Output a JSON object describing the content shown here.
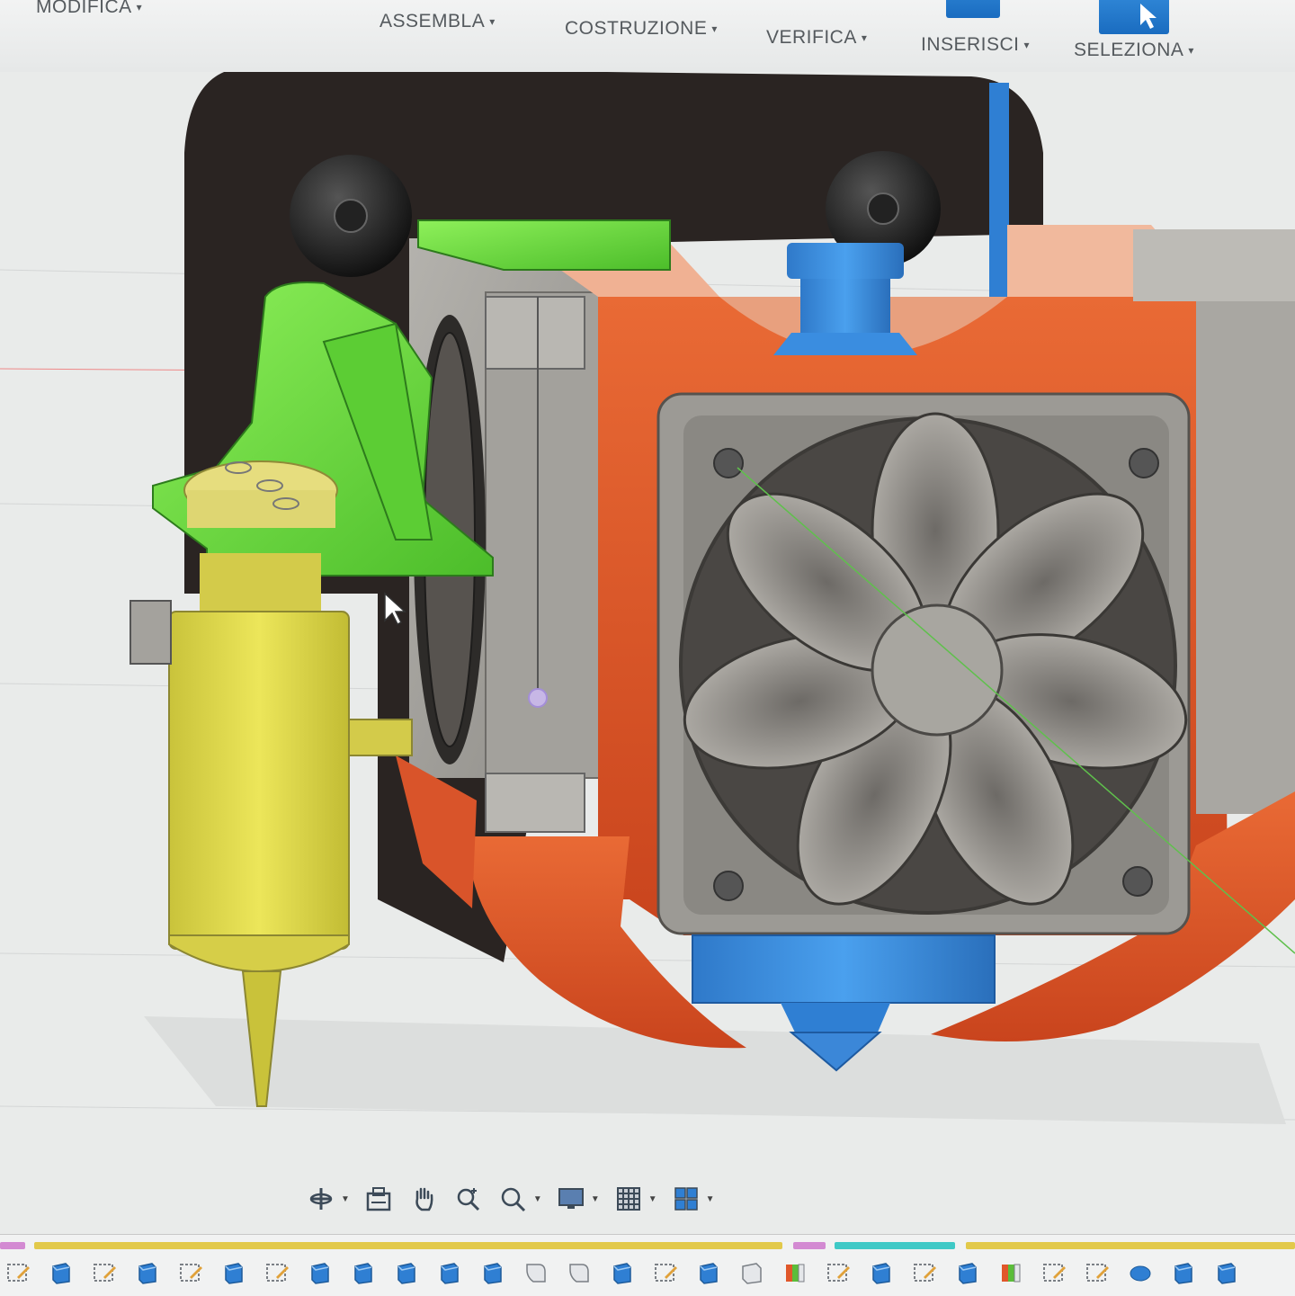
{
  "toolbar": {
    "menus": [
      {
        "label": "MODIFICA"
      },
      {
        "label": "ASSEMBLA"
      },
      {
        "label": "COSTRUZIONE"
      },
      {
        "label": "VERIFICA"
      },
      {
        "label": "INSERISCI"
      },
      {
        "label": "SELEZIONA"
      }
    ],
    "caret": "▾"
  },
  "viewport": {
    "model": "3d-printer-hotend-fan-shroud-assembly",
    "colors": {
      "back_plate": "#2a2422",
      "fan_duct": "#e0572a",
      "probe_mount": "#6ad33c",
      "probe_body": "#d6d24a",
      "hotend": "#3b87d8",
      "fan_frame": "#8c8a85",
      "blower": "#a9a7a2",
      "background": "#e9ebea"
    }
  },
  "nav_bar": {
    "tools": [
      {
        "icon": "orbit-icon",
        "has_menu": true
      },
      {
        "icon": "look-at-icon",
        "has_menu": false
      },
      {
        "icon": "pan-hand-icon",
        "has_menu": false
      },
      {
        "icon": "zoom-icon",
        "has_menu": false
      },
      {
        "icon": "zoom-window-icon",
        "has_menu": true
      },
      {
        "icon": "display-settings-icon",
        "has_menu": true
      },
      {
        "icon": "grid-icon",
        "has_menu": true
      },
      {
        "icon": "viewports-icon",
        "has_menu": true
      }
    ]
  },
  "timeline": {
    "group_colors": [
      "#d38ad2",
      "#e2c94a",
      "#d38ad2",
      "#3fc9c6",
      "#e2c94a"
    ],
    "item_icons": [
      "sketch-icon",
      "extrude-icon",
      "sketch-icon",
      "extrude-icon",
      "sketch-icon",
      "extrude-icon",
      "sketch-icon",
      "extrude-icon",
      "extrude-icon",
      "extrude-icon",
      "extrude-icon",
      "extrude-icon",
      "fillet-icon",
      "fillet-icon",
      "extrude-icon",
      "sketch-icon",
      "extrude-icon",
      "component-icon",
      "appearance-icon",
      "sketch-icon",
      "extrude-icon",
      "sketch-icon",
      "extrude-icon",
      "appearance-icon",
      "sketch-icon",
      "sketch-icon",
      "body-icon",
      "extrude-icon",
      "extrude-icon"
    ]
  }
}
